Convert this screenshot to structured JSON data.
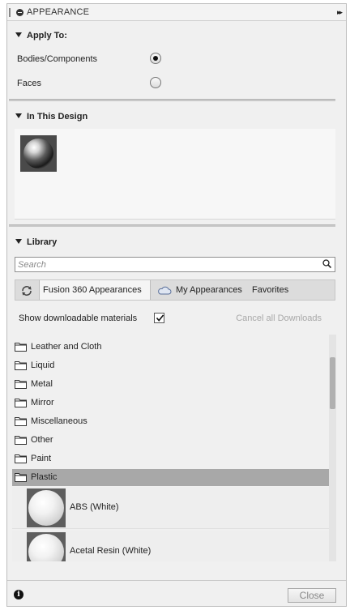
{
  "titlebar": {
    "title": "APPEARANCE",
    "expand_glyph": "▸▸"
  },
  "apply_to": {
    "heading": "Apply To:",
    "options": [
      {
        "label": "Bodies/Components",
        "selected": true
      },
      {
        "label": "Faces",
        "selected": false
      }
    ]
  },
  "in_this_design": {
    "heading": "In This Design",
    "materials": [
      {
        "icon": "chrome-sphere-swatch"
      }
    ]
  },
  "library": {
    "heading": "Library",
    "search": {
      "placeholder": "Search",
      "value": ""
    },
    "tabs": [
      {
        "label": "Fusion 360 Appearances",
        "active": true
      },
      {
        "label": "My Appearances",
        "active": false
      },
      {
        "label": "Favorites",
        "active": false
      }
    ],
    "show_downloadable_label": "Show downloadable materials",
    "show_downloadable_checked": true,
    "cancel_downloads_label": "Cancel all Downloads",
    "folders": [
      {
        "label": "Leather and Cloth",
        "selected": false
      },
      {
        "label": "Liquid",
        "selected": false
      },
      {
        "label": "Metal",
        "selected": false
      },
      {
        "label": "Mirror",
        "selected": false
      },
      {
        "label": "Miscellaneous",
        "selected": false
      },
      {
        "label": "Other",
        "selected": false
      },
      {
        "label": "Paint",
        "selected": false
      },
      {
        "label": "Plastic",
        "selected": true
      }
    ],
    "materials": [
      {
        "label": "ABS (White)"
      },
      {
        "label": "Acetal Resin (White)"
      }
    ]
  },
  "footer": {
    "close_label": "Close",
    "info_glyph": "i"
  },
  "colors": {
    "selected_row": "#a8a8a8",
    "panel_bg": "#f0f0f0",
    "disabled_text": "#a8a8a8"
  }
}
